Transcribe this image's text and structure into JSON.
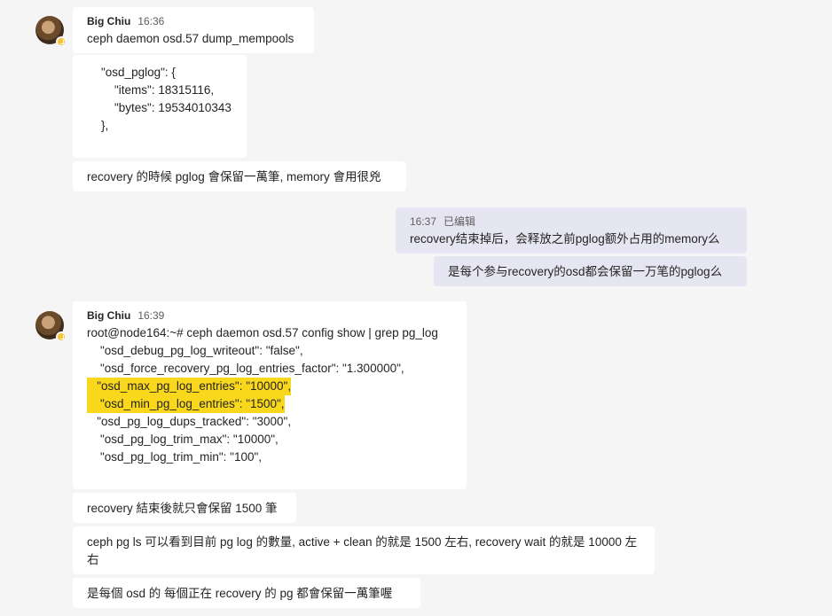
{
  "messages": {
    "m1": {
      "sender": "Big Chiu",
      "time": "16:36",
      "text": "ceph daemon osd.57 dump_mempools"
    },
    "m2": {
      "lines": [
        "\"osd_pglog\": {",
        "    \"items\": 18315116,",
        "    \"bytes\": 19534010343",
        "},"
      ]
    },
    "m3": {
      "text": "recovery 的時候 pglog 會保留一萬筆, memory 會用很兇"
    },
    "m4": {
      "time": "16:37",
      "edited": "已编辑",
      "text": "recovery结束掉后，会释放之前pglog额外占用的memory么"
    },
    "m5": {
      "text": "是每个参与recovery的osd都会保留一万笔的pglog么"
    },
    "m6": {
      "sender": "Big Chiu",
      "time": "16:39",
      "lines": [
        "root@node164:~# ceph daemon osd.57 config show | grep pg_log",
        "    \"osd_debug_pg_log_writeout\": \"false\",",
        "    \"osd_force_recovery_pg_log_entries_factor\": \"1.300000\",",
        "   \"osd_max_pg_log_entries\": \"10000\",",
        "    \"osd_min_pg_log_entries\": \"1500\",",
        "   \"osd_pg_log_dups_tracked\": \"3000\",",
        "    \"osd_pg_log_trim_max\": \"10000\",",
        "    \"osd_pg_log_trim_min\": \"100\","
      ]
    },
    "m7": {
      "text": "recovery 結束後就只會保留 1500 筆"
    },
    "m8": {
      "text": "ceph pg ls 可以看到目前 pg log 的數量, active + clean 的就是 1500 左右, recovery wait 的就是 10000 左右"
    },
    "m9": {
      "text": "是每個 osd 的 每個正在 recovery 的 pg  都會保留一萬筆喔"
    }
  },
  "colors": {
    "highlight": "#f9d71c",
    "my_bubble": "#e6e6f2",
    "status": "#f8c232"
  },
  "icons": {
    "avatar": "user-avatar",
    "status": "away-status-icon"
  }
}
